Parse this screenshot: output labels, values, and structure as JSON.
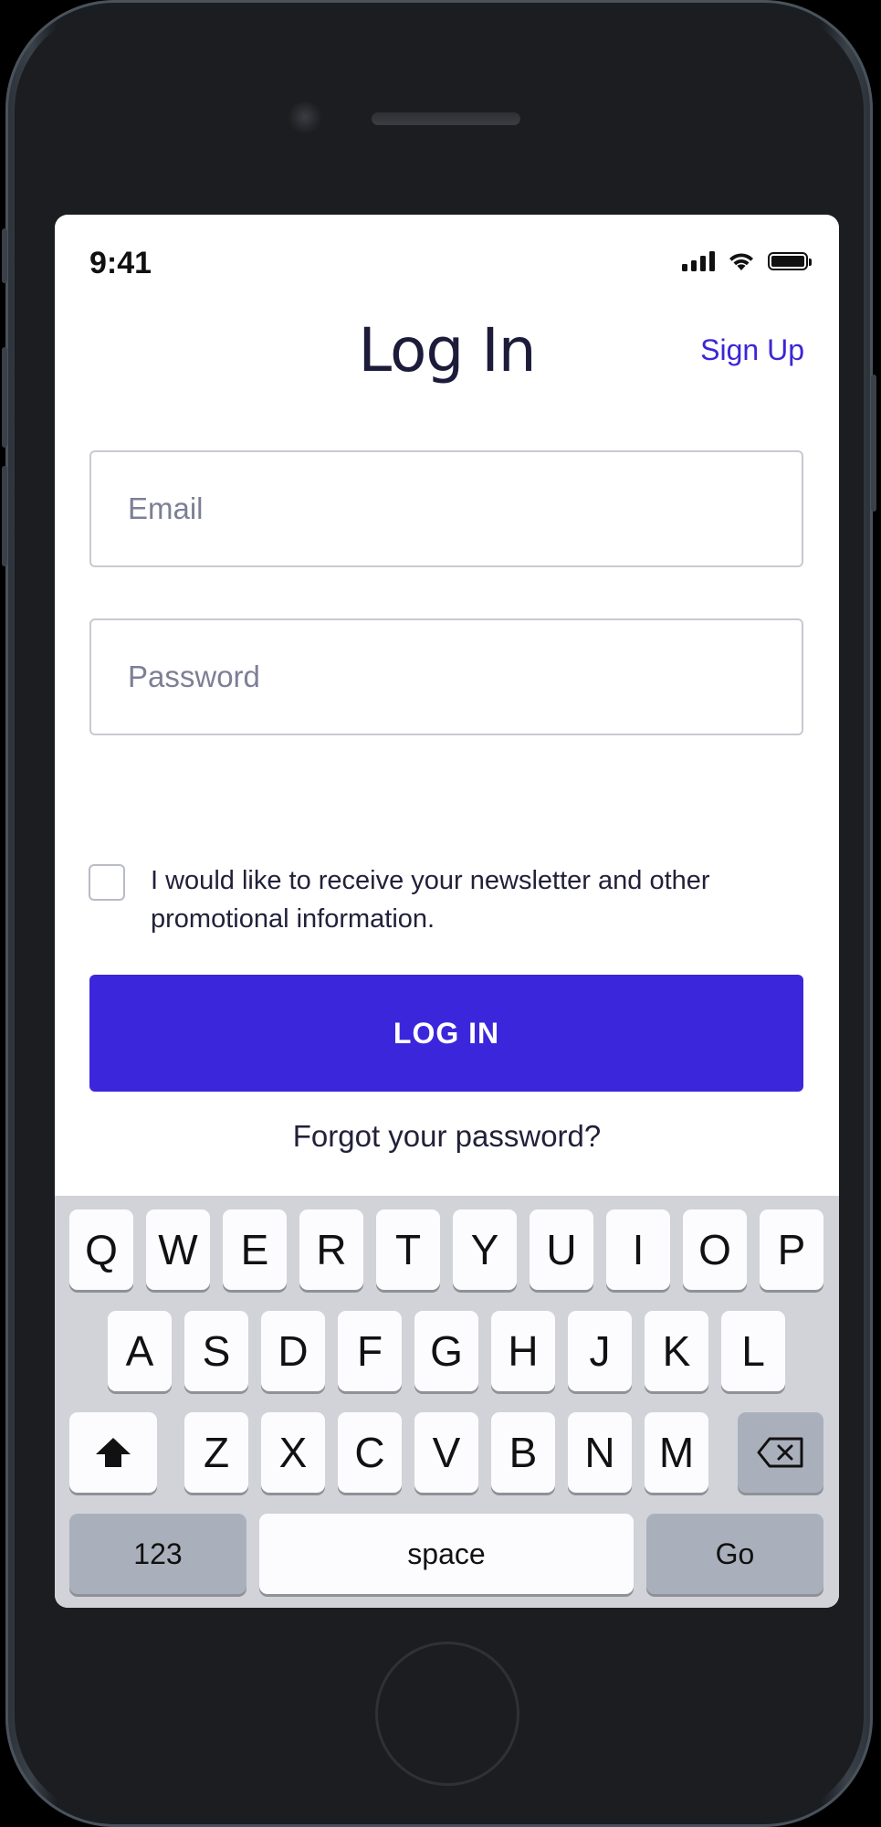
{
  "status_bar": {
    "time": "9:41"
  },
  "header": {
    "title": "Log In",
    "signup_link": "Sign Up"
  },
  "form": {
    "email_placeholder": "Email",
    "password_placeholder": "Password",
    "newsletter_label": "I would like to receive your newsletter and other promotional information.",
    "newsletter_checked": false,
    "login_button": "LOG IN",
    "forgot_password": "Forgot your password?"
  },
  "keyboard": {
    "row1": [
      "Q",
      "W",
      "E",
      "R",
      "T",
      "Y",
      "U",
      "I",
      "O",
      "P"
    ],
    "row2": [
      "A",
      "S",
      "D",
      "F",
      "G",
      "H",
      "J",
      "K",
      "L"
    ],
    "row3": [
      "Z",
      "X",
      "C",
      "V",
      "B",
      "N",
      "M"
    ],
    "shift_icon": "shift-arrow-icon",
    "backspace_icon": "backspace-icon",
    "numbers_key": "123",
    "space_key": "space",
    "go_key": "Go"
  },
  "colors": {
    "accent": "#3c26dc",
    "link": "#3b26d6",
    "keyboard_bg": "#d1d3d9"
  }
}
